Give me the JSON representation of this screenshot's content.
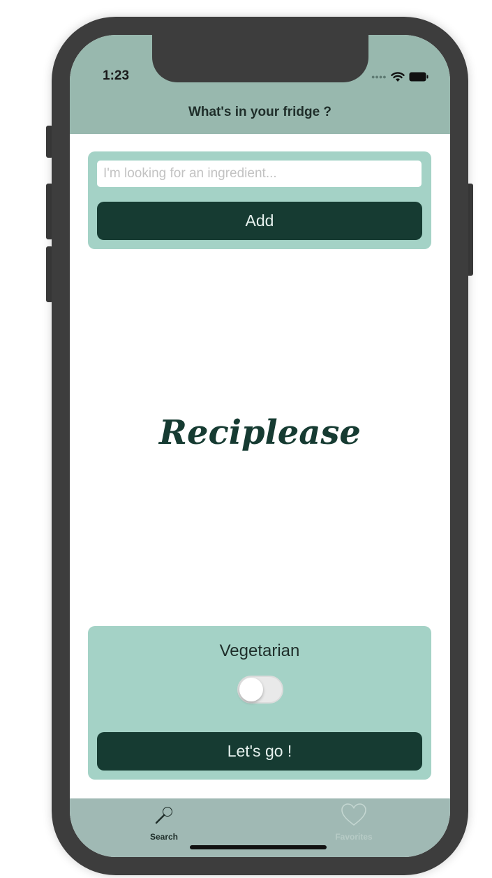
{
  "status_bar": {
    "time": "1:23",
    "signal_icon": "signal-dots-icon",
    "wifi_icon": "wifi-icon",
    "battery_icon": "battery-icon"
  },
  "nav": {
    "title": "What's in your fridge ?"
  },
  "search": {
    "value": "",
    "placeholder": "I'm looking for an ingredient...",
    "add_label": "Add"
  },
  "logo": {
    "text": "Reciplease"
  },
  "options": {
    "vegetarian_label": "Vegetarian",
    "vegetarian_on": false,
    "go_label": "Let's go !"
  },
  "tabbar": {
    "tabs": [
      {
        "label": "Search",
        "icon": "search-icon",
        "selected": true
      },
      {
        "label": "Favorites",
        "icon": "heart-icon",
        "selected": false
      }
    ]
  },
  "colors": {
    "accent_dark": "#163b32",
    "card_bg": "#a4d2c6",
    "bar_bg": "#98b8ae",
    "tab_bar_bg": "#a0b9b4"
  }
}
